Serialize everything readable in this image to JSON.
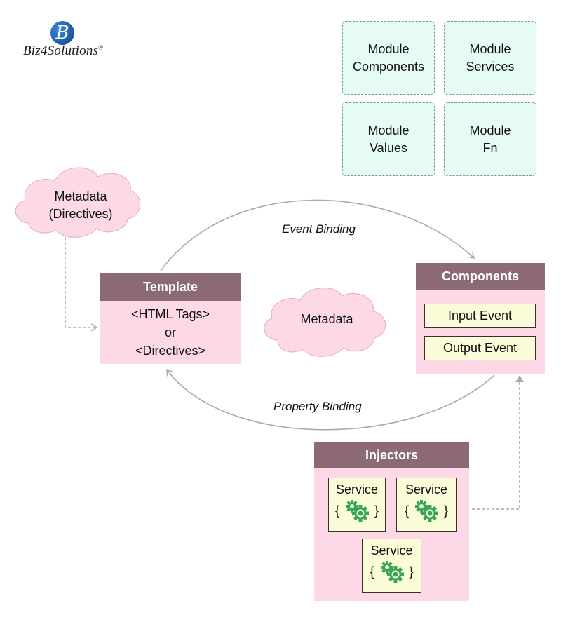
{
  "logo": {
    "mark": "B",
    "name": "Biz4Solutions",
    "registered": "®"
  },
  "modules": [
    {
      "line1": "Module",
      "line2": "Components"
    },
    {
      "line1": "Module",
      "line2": "Services"
    },
    {
      "line1": "Module",
      "line2": "Values"
    },
    {
      "line1": "Module",
      "line2": "Fn"
    }
  ],
  "clouds": {
    "directives": {
      "line1": "Metadata",
      "line2": "(Directives)"
    },
    "center": {
      "label": "Metadata"
    }
  },
  "template": {
    "title": "Template",
    "line1": "<HTML Tags>",
    "line2": "or",
    "line3": "<Directives>"
  },
  "components": {
    "title": "Components",
    "input_event": "Input Event",
    "output_event": "Output Event"
  },
  "bindings": {
    "event": "Event Binding",
    "property": "Property Binding"
  },
  "injectors": {
    "title": "Injectors",
    "services": [
      {
        "label": "Service",
        "open": "{",
        "close": "}",
        "icon": "gears-icon"
      },
      {
        "label": "Service",
        "open": "{",
        "close": "}",
        "icon": "gears-icon"
      },
      {
        "label": "Service",
        "open": "{",
        "close": "}",
        "icon": "gears-icon"
      }
    ]
  },
  "colors": {
    "header": "#8c6a75",
    "panel": "#fdd8e6",
    "module": "#e6fbf2",
    "event_box": "#fbfdd9",
    "gear": "#3aa655",
    "connector": "#aaaaaa"
  }
}
